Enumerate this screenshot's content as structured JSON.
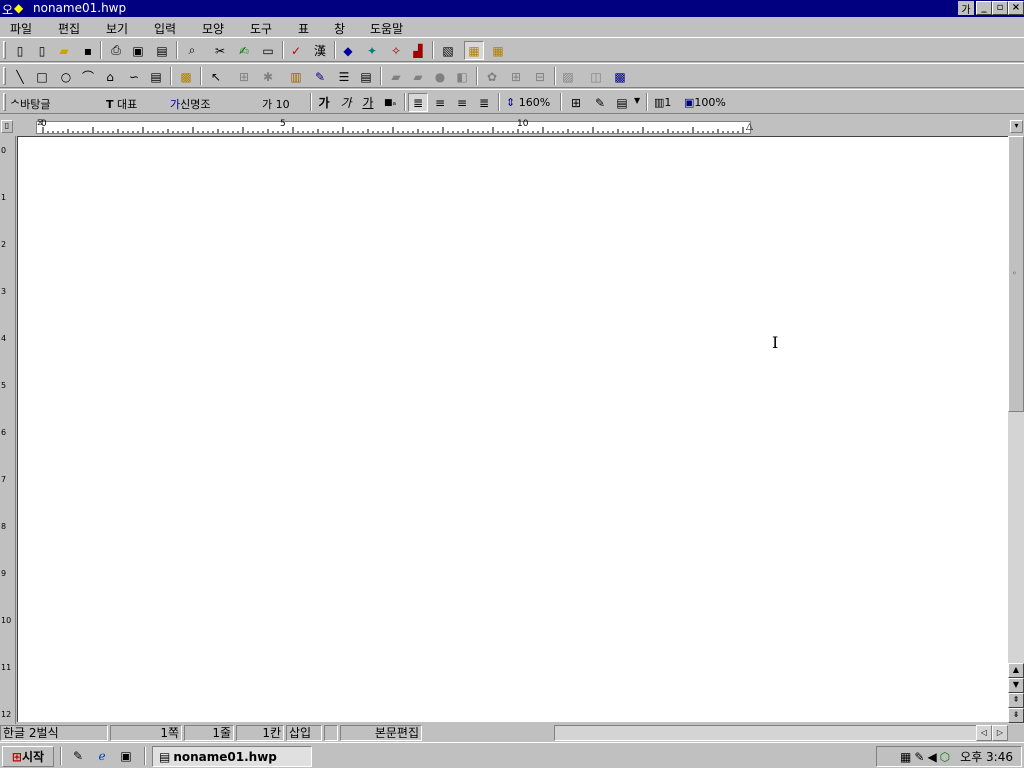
{
  "window": {
    "title": "noname01.hwp"
  },
  "menu": [
    "파일",
    "편집",
    "보기",
    "입력",
    "모양",
    "도구",
    "표",
    "창",
    "도움말"
  ],
  "format_bar": {
    "style": "바탕글",
    "rep_font": "대표",
    "font_name": "신명조",
    "font_size": "10",
    "line_spacing": "160%",
    "columns": "1",
    "zoom": "100%"
  },
  "ruler": {
    "labels": [
      "0",
      "5",
      "10"
    ]
  },
  "vruler": {
    "labels": [
      "0",
      "1",
      "2",
      "3",
      "4",
      "5",
      "6",
      "7",
      "8",
      "9",
      "10",
      "11",
      "12"
    ]
  },
  "status": {
    "mode": "한글 2벌식",
    "page": "1쪽",
    "line": "1줄",
    "col": "1칸",
    "insert": "삽입",
    "edit": "본문편집"
  },
  "taskbar": {
    "start": "시작",
    "task": "noname01.hwp",
    "clock": "오후 3:46"
  }
}
